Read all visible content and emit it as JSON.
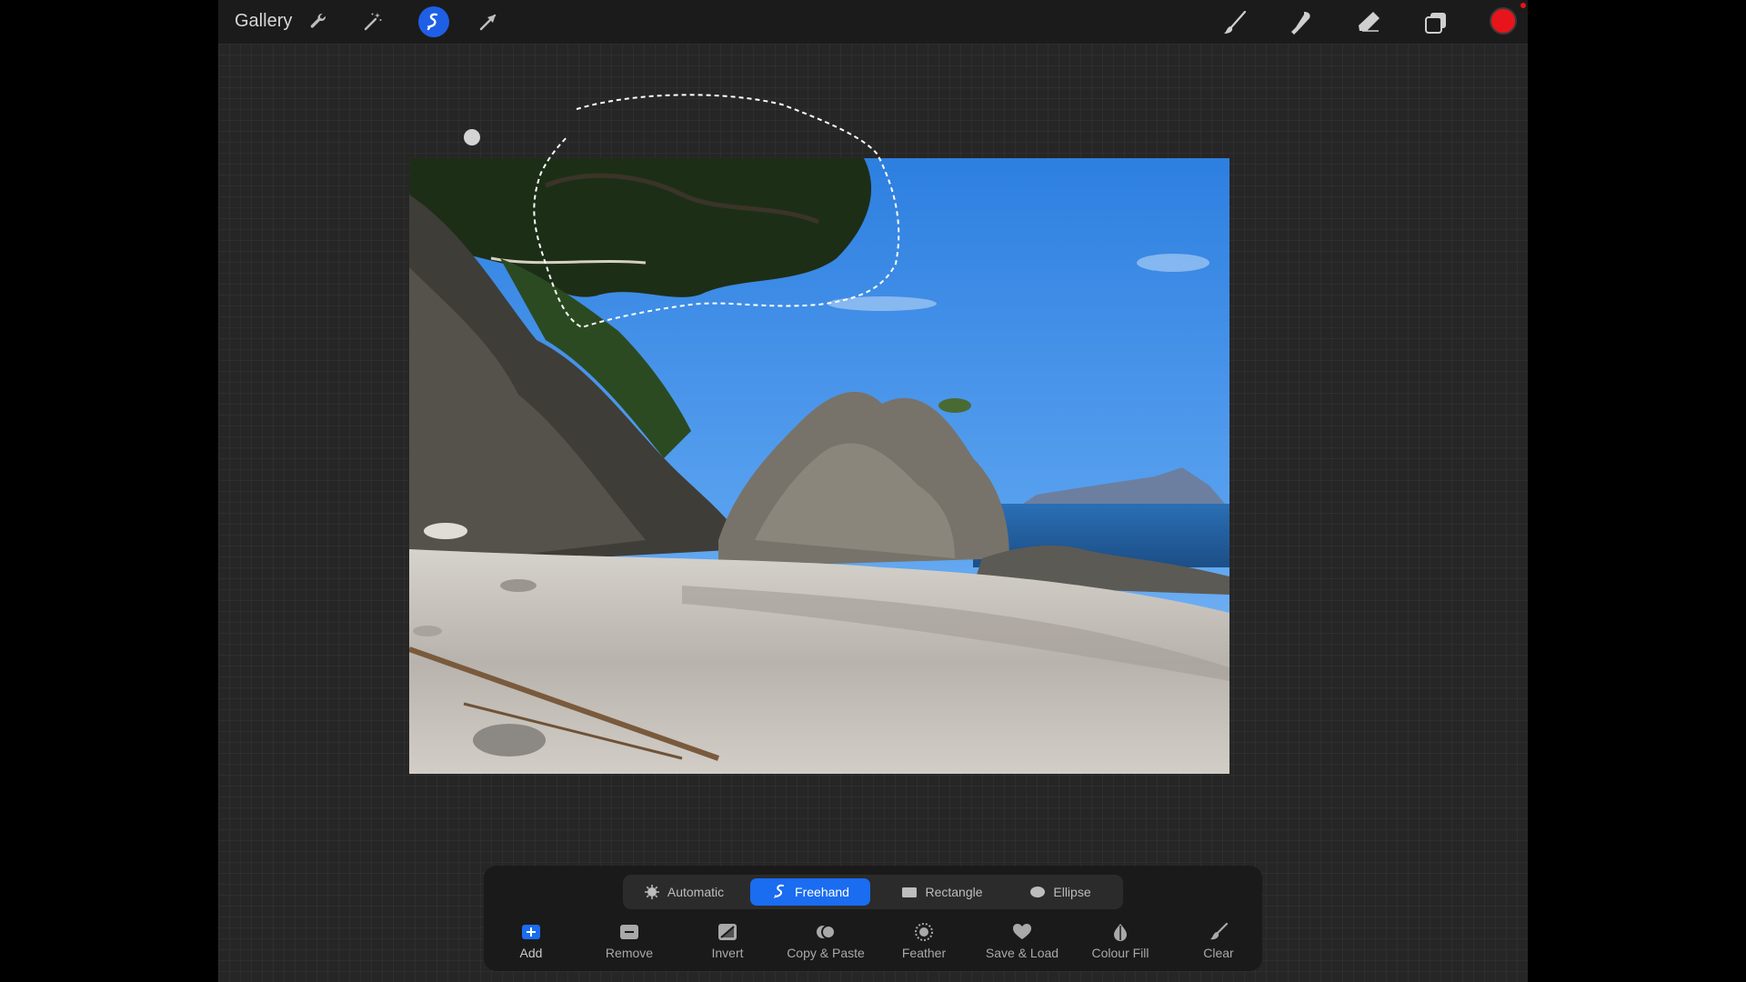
{
  "topbar": {
    "gallery_label": "Gallery",
    "left_tools": [
      "wrench-icon",
      "magic-wand-icon",
      "selection-icon",
      "transform-arrow-icon"
    ],
    "right_tools": [
      "brush-icon",
      "smudge-icon",
      "eraser-icon",
      "layers-icon"
    ],
    "current_color": "#e8141b",
    "accent_color": "#1e5fe6"
  },
  "selection": {
    "modes": [
      {
        "label": "Automatic",
        "icon": "automatic-icon",
        "active": false
      },
      {
        "label": "Freehand",
        "icon": "freehand-icon",
        "active": true
      },
      {
        "label": "Rectangle",
        "icon": "rectangle-icon",
        "active": false
      },
      {
        "label": "Ellipse",
        "icon": "ellipse-icon",
        "active": false
      }
    ],
    "actions": [
      {
        "label": "Add",
        "icon": "add-icon"
      },
      {
        "label": "Remove",
        "icon": "remove-icon"
      },
      {
        "label": "Invert",
        "icon": "invert-icon"
      },
      {
        "label": "Copy & Paste",
        "icon": "copy-paste-icon"
      },
      {
        "label": "Feather",
        "icon": "feather-icon"
      },
      {
        "label": "Save & Load",
        "icon": "heart-icon"
      },
      {
        "label": "Colour Fill",
        "icon": "colour-fill-icon"
      },
      {
        "label": "Clear",
        "icon": "clear-brush-icon"
      }
    ]
  }
}
